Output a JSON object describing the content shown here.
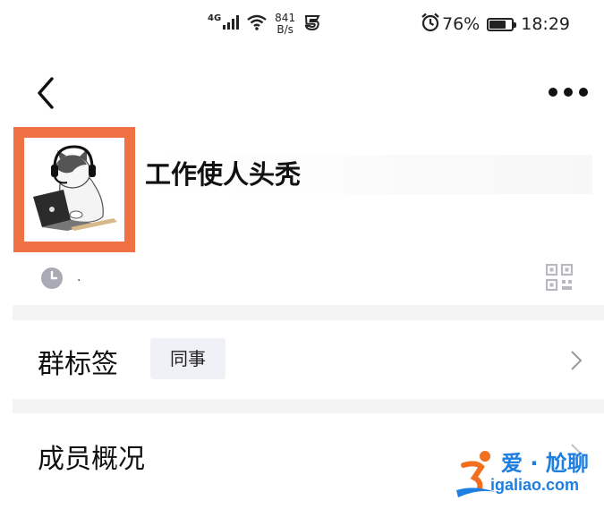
{
  "status_bar": {
    "network_type": "4G",
    "speed_value": "841",
    "speed_unit": "B/s",
    "battery_percent": "76%",
    "battery_level": 0.76,
    "time": "18:29"
  },
  "header": {
    "back_icon": "chevron-left-icon",
    "more_icon": "more-dots-icon"
  },
  "group": {
    "name": "工作使人头秃",
    "description": ".",
    "avatar": "cat-with-headset-at-laptop",
    "highlight_color": "#f07244"
  },
  "rows": {
    "tags": {
      "label": "群标签",
      "tag": "同事"
    },
    "overview": {
      "label": "成员概况"
    }
  },
  "watermark": {
    "text": "爱 · 尬聊",
    "url": "igaliao.com"
  },
  "colors": {
    "accent": "#f07244",
    "watermark": "#1f7fe0",
    "tag_bg": "#f0f1f6"
  }
}
